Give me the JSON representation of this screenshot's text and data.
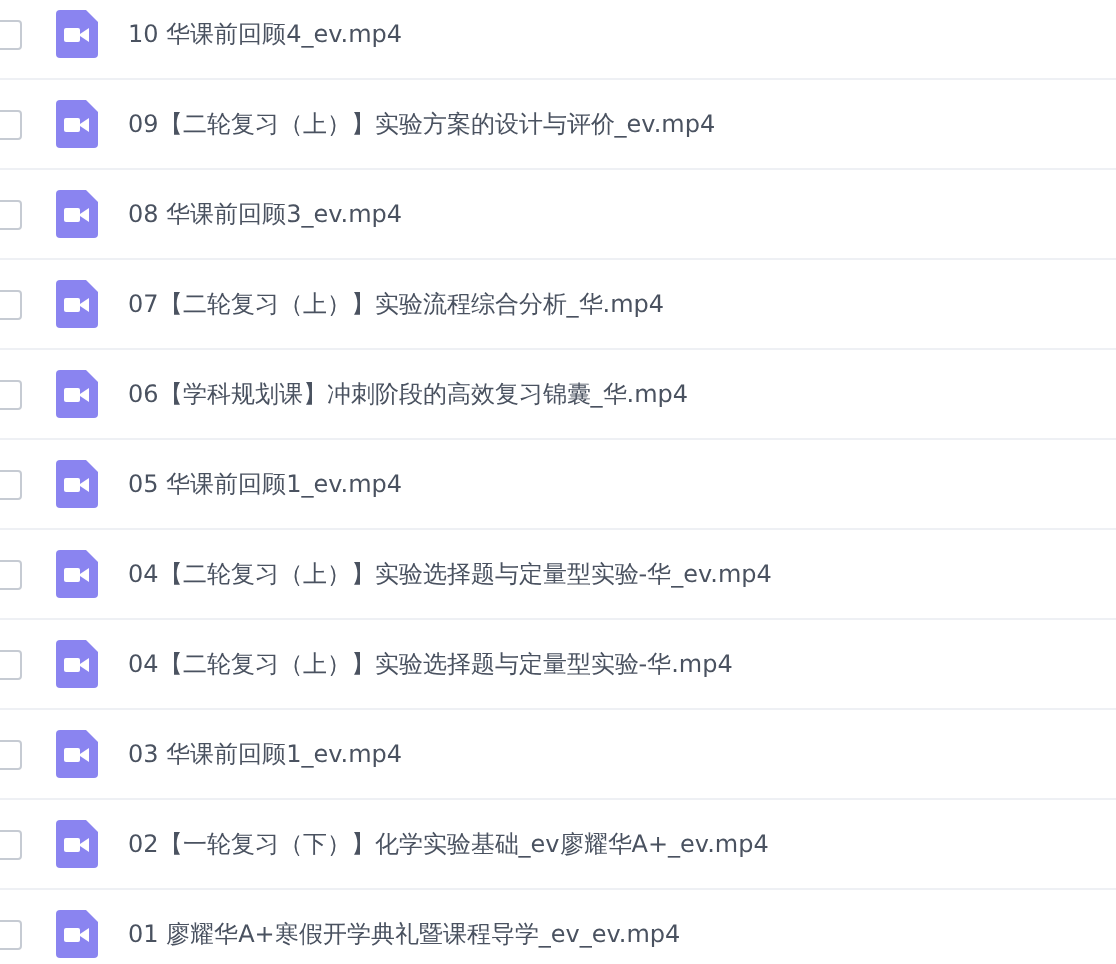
{
  "files": [
    {
      "name": "10 华课前回顾4_ev.mp4",
      "checked": false
    },
    {
      "name": "09【二轮复习（上）】实验方案的设计与评价_ev.mp4",
      "checked": false
    },
    {
      "name": "08 华课前回顾3_ev.mp4",
      "checked": false
    },
    {
      "name": "07【二轮复习（上）】实验流程综合分析_华.mp4",
      "checked": false
    },
    {
      "name": "06【学科规划课】冲刺阶段的高效复习锦囊_华.mp4",
      "checked": false
    },
    {
      "name": "05 华课前回顾1_ev.mp4",
      "checked": false
    },
    {
      "name": "04【二轮复习（上）】实验选择题与定量型实验-华_ev.mp4",
      "checked": false
    },
    {
      "name": "04【二轮复习（上）】实验选择题与定量型实验-华.mp4",
      "checked": false
    },
    {
      "name": "03 华课前回顾1_ev.mp4",
      "checked": false
    },
    {
      "name": "02【一轮复习（下）】化学实验基础_ev廖耀华A+_ev.mp4",
      "checked": false
    },
    {
      "name": "01 廖耀华A+寒假开学典礼暨课程导学_ev_ev.mp4",
      "checked": false
    }
  ]
}
